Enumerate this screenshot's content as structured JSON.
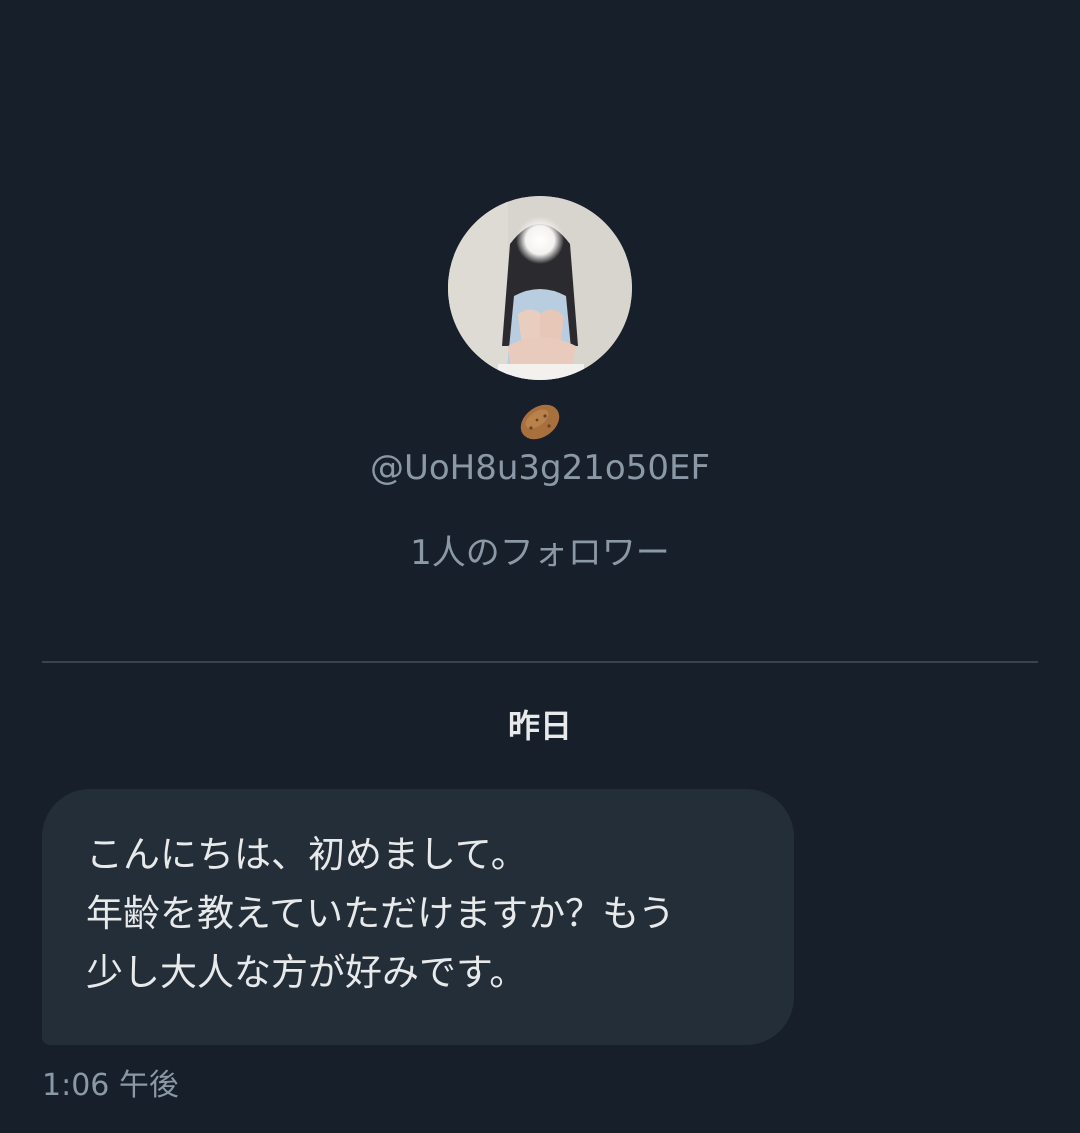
{
  "profile": {
    "avatar_icon": "profile-photo",
    "name_emoji": "potato-emoji",
    "handle": "@UoH8u3g21o50EF",
    "followers": "1人のフォロワー"
  },
  "conversation": {
    "date_separator": "昨日",
    "messages": [
      {
        "lines": [
          "こんにちは、初めまして。",
          "年齢を教えていただけますか？もう",
          "少し大人な方が好みです。"
        ],
        "time": "1:06 午後"
      }
    ]
  },
  "colors": {
    "background": "#161f2a",
    "bubble": "#232e38",
    "secondary_text": "#8b98a5",
    "primary_text": "#e7e9ea",
    "divider": "#38444d"
  }
}
